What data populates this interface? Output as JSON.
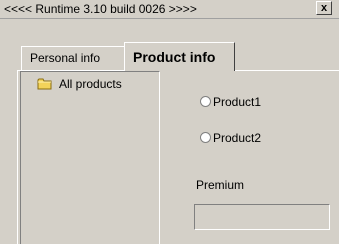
{
  "window": {
    "title": "<<<< Runtime 3.10 build 0026 >>>>",
    "close_label": "x"
  },
  "tabs": [
    {
      "label": "Personal info",
      "active": false
    },
    {
      "label": "Product info",
      "active": true
    }
  ],
  "tree": {
    "items": [
      {
        "label": "All products",
        "icon": "folder-icon"
      }
    ]
  },
  "product_options": [
    {
      "label": "Product1",
      "selected": false
    },
    {
      "label": "Product2",
      "selected": false
    }
  ],
  "premium": {
    "label": "Premium",
    "value": ""
  },
  "colors": {
    "background": "#d4d0c8",
    "folder": "#f3d35a"
  }
}
